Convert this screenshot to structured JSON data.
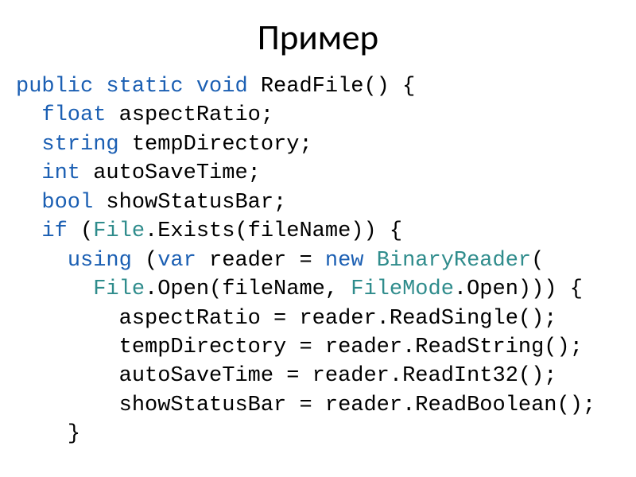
{
  "title": "Пример",
  "code": {
    "line1": {
      "kw1": "public",
      "kw2": "static",
      "kw3": "void",
      "rest": " ReadFile() {"
    },
    "line2": {
      "indent": "  ",
      "kw": "float",
      "rest": " aspectRatio;"
    },
    "line3": {
      "indent": "  ",
      "kw": "string",
      "rest": " tempDirectory;"
    },
    "line4": {
      "indent": "  ",
      "kw": "int",
      "rest": " autoSaveTime;"
    },
    "line5": {
      "indent": "  ",
      "kw": "bool",
      "rest": " showStatusBar;"
    },
    "line6": {
      "indent": "  ",
      "kw": "if",
      "p1": " (",
      "cls": "File",
      "rest": ".Exists(fileName)) {"
    },
    "line7": {
      "indent": "    ",
      "kw1": "using",
      "p1": " (",
      "kw2": "var",
      "mid": " reader = ",
      "kw3": "new",
      "sp": " ",
      "cls": "BinaryReader",
      "rest": "("
    },
    "line8": {
      "indent": "      ",
      "cls1": "File",
      "mid": ".Open(fileName, ",
      "cls2": "FileMode",
      "rest": ".Open))) {"
    },
    "line9": {
      "indent": "        ",
      "rest": "aspectRatio = reader.ReadSingle();"
    },
    "line10": {
      "indent": "        ",
      "rest": "tempDirectory = reader.ReadString();"
    },
    "line11": {
      "indent": "        ",
      "rest": "autoSaveTime = reader.ReadInt32();"
    },
    "line12": {
      "indent": "        ",
      "rest": "showStatusBar = reader.ReadBoolean();"
    },
    "line13": {
      "indent": "    ",
      "rest": "}"
    }
  }
}
